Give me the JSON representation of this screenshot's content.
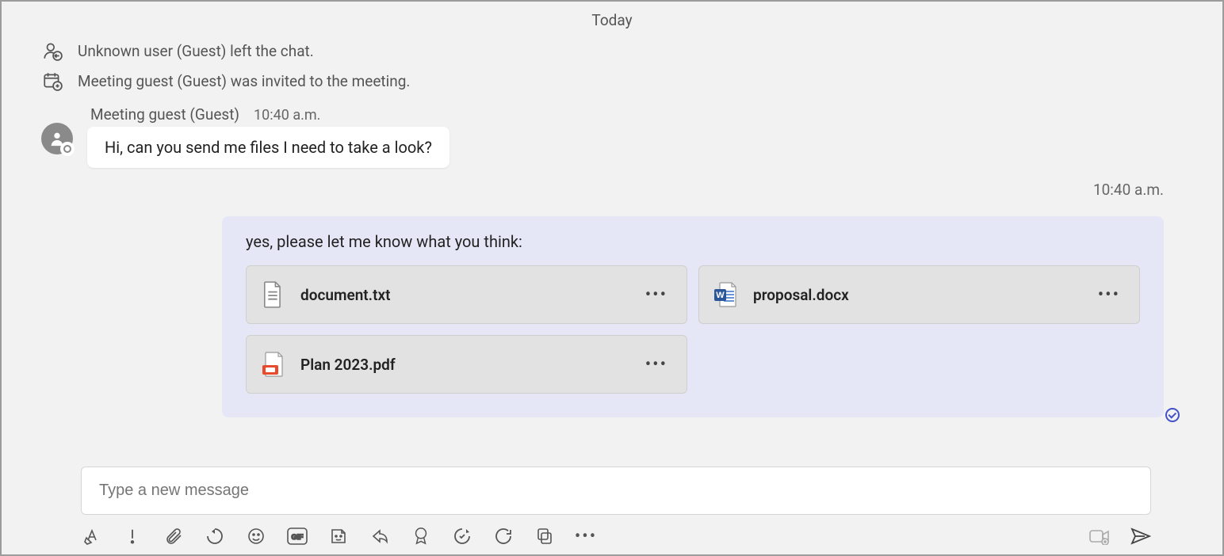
{
  "date_label": "Today",
  "system_events": [
    {
      "icon": "user-left-icon",
      "text": "Unknown user (Guest) left the chat."
    },
    {
      "icon": "meeting-invite-icon",
      "text": "Meeting guest (Guest) was invited to the meeting."
    }
  ],
  "incoming": {
    "sender": "Meeting guest (Guest)",
    "time": "10:40 a.m.",
    "text": "Hi, can you send me files I need to take a look?"
  },
  "outgoing": {
    "time": "10:40 a.m.",
    "text": "yes, please let me know what you think:",
    "files": [
      {
        "name": "document.txt",
        "type": "text"
      },
      {
        "name": "proposal.docx",
        "type": "word"
      },
      {
        "name": "Plan 2023.pdf",
        "type": "pdf"
      }
    ]
  },
  "compose": {
    "placeholder": "Type a new message"
  },
  "more_glyph": "•••"
}
